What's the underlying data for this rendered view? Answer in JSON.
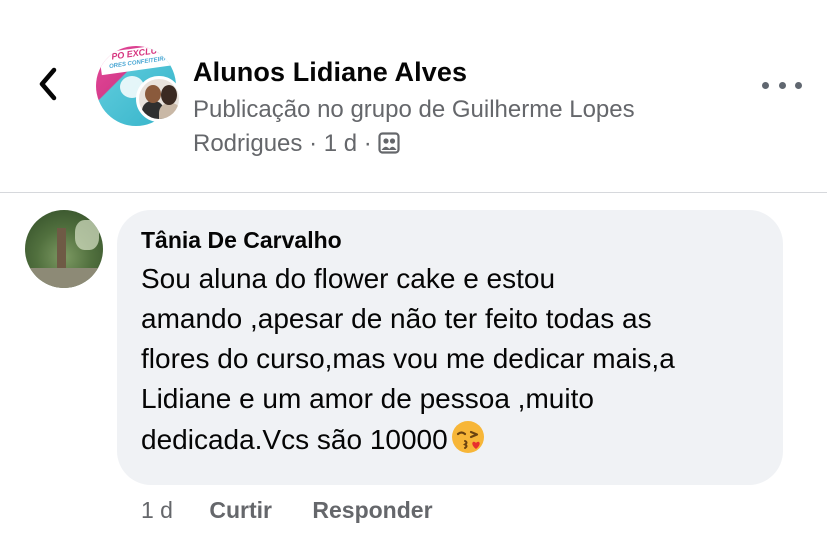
{
  "header": {
    "back_icon": "chevron-left-icon",
    "group_name": "Alunos Lidiane Alves",
    "post_subtitle": "Publicação no grupo de Guilherme Lopes Rodrigues",
    "time": "1 d",
    "separator": "·",
    "privacy_icon": "group-members-icon",
    "more_icon": "more-horizontal-icon",
    "group_avatar": {
      "banner_text": "PO EXCLUS",
      "banner_sub": "ORES CONFEITEIRA"
    }
  },
  "comment": {
    "author": "Tânia De Carvalho",
    "text_lines": [
      "Sou aluna do flower cake e estou",
      "amando ,apesar de não ter feito todas as",
      "flores do curso,mas vou me dedicar mais,a",
      "Lidiane e um amor de pessoa ,muito",
      "dedicada.Vcs são 10000"
    ],
    "emoji": "face-blowing-kiss-emoji",
    "time": "1 d",
    "like_label": "Curtir",
    "reply_label": "Responder"
  },
  "colors": {
    "secondary_text": "#65676b",
    "bubble_bg": "#f0f2f5",
    "divider": "#d6d8dc"
  }
}
